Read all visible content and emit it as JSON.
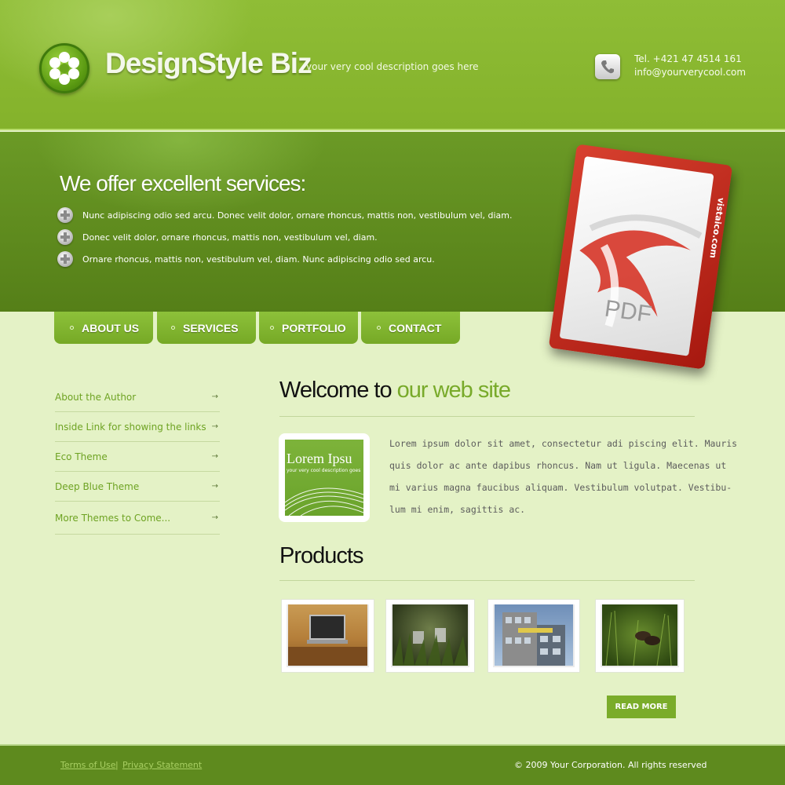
{
  "header": {
    "brand": "DesignStyle Biz",
    "tagline": "your very cool description goes here",
    "phone": "Tel. +421 47 4514 161",
    "email": "info@yourverycool.com"
  },
  "banner": {
    "title": "We offer excellent services:",
    "bullets": [
      "Nunc adipiscing odio sed arcu. Donec velit dolor, ornare rhoncus, mattis non, vestibulum vel, diam.",
      "Donec velit dolor, ornare rhoncus, mattis non, vestibulum vel, diam.",
      "Ornare rhoncus, mattis non, vestibulum vel, diam. Nunc adipiscing odio sed arcu."
    ],
    "pdf_label": "PDF",
    "pdf_side_text": "vistaico.com"
  },
  "nav": {
    "items": [
      "ABOUT US",
      "SERVICES",
      "PORTFOLIO",
      "CONTACT"
    ]
  },
  "sidebar": {
    "items": [
      "About the Author",
      "Inside Link for showing the links",
      "Eco Theme",
      "Deep Blue Theme",
      "More Themes to Come..."
    ],
    "arrow": "→"
  },
  "main": {
    "welcome_prefix": "Welcome to",
    "welcome_accent": "our web site",
    "thumb_title": "Lorem Ipsu",
    "thumb_subtitle": "your very cool description goes",
    "intro_lines": [
      "Lorem ipsum dolor sit amet, consectetur adi piscing elit. Mauris",
      "quis dolor ac ante dapibus rhoncus. Nam ut ligula. Maecenas ut",
      "mi varius magna faucibus aliquam. Vestibulum volutpat. Vestibu-",
      "lum mi enim, sagittis ac."
    ],
    "products_title": "Products",
    "read_more": "READ MORE"
  },
  "footer": {
    "terms": "Terms of Use",
    "separator": "|",
    "privacy": "Privacy Statement",
    "copyright": "© 2009 Your Corporation. All rights reserved"
  },
  "colors": {
    "header_green": "#8fbd36",
    "banner_green": "#5f8c1e",
    "page_background": "#e4f2c6",
    "accent_green": "#78aa2a",
    "footer_green": "#5e8a1e"
  }
}
